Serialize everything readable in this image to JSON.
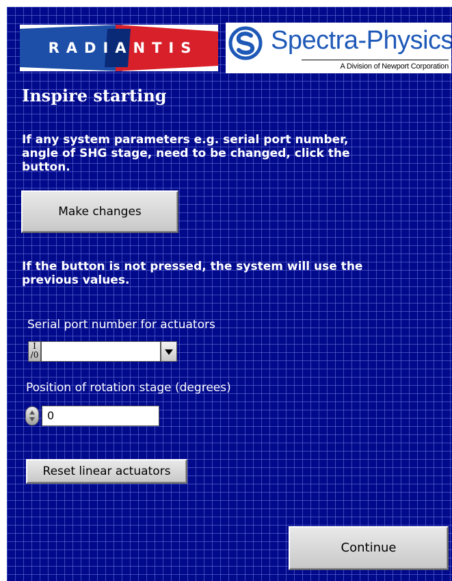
{
  "logos": {
    "radiantis": "RADIANTIS",
    "spectra_name": "Spectra-Physics",
    "spectra_division": "A Division of Newport Corporation"
  },
  "title": "Inspire starting",
  "paragraphs": {
    "change_prompt": "If any system parameters e.g. serial port number, angle of SHG stage, need to be changed, click the button.",
    "default_note": "If the button is not pressed, the system will use the previous values."
  },
  "buttons": {
    "make_changes": "Make changes",
    "reset_actuators": "Reset linear actuators",
    "continue": "Continue"
  },
  "serial_port": {
    "label": "Serial port number for actuators",
    "io_glyph": "I/O",
    "value": ""
  },
  "rotation_stage": {
    "label": "Position of rotation stage (degrees)",
    "value": "0"
  },
  "colors": {
    "background": "#020a8c",
    "grid": "#6e78dc",
    "radiantis_red": "#d8202a",
    "radiantis_blue": "#1d4fa8",
    "spectra_blue": "#1f59b8"
  }
}
